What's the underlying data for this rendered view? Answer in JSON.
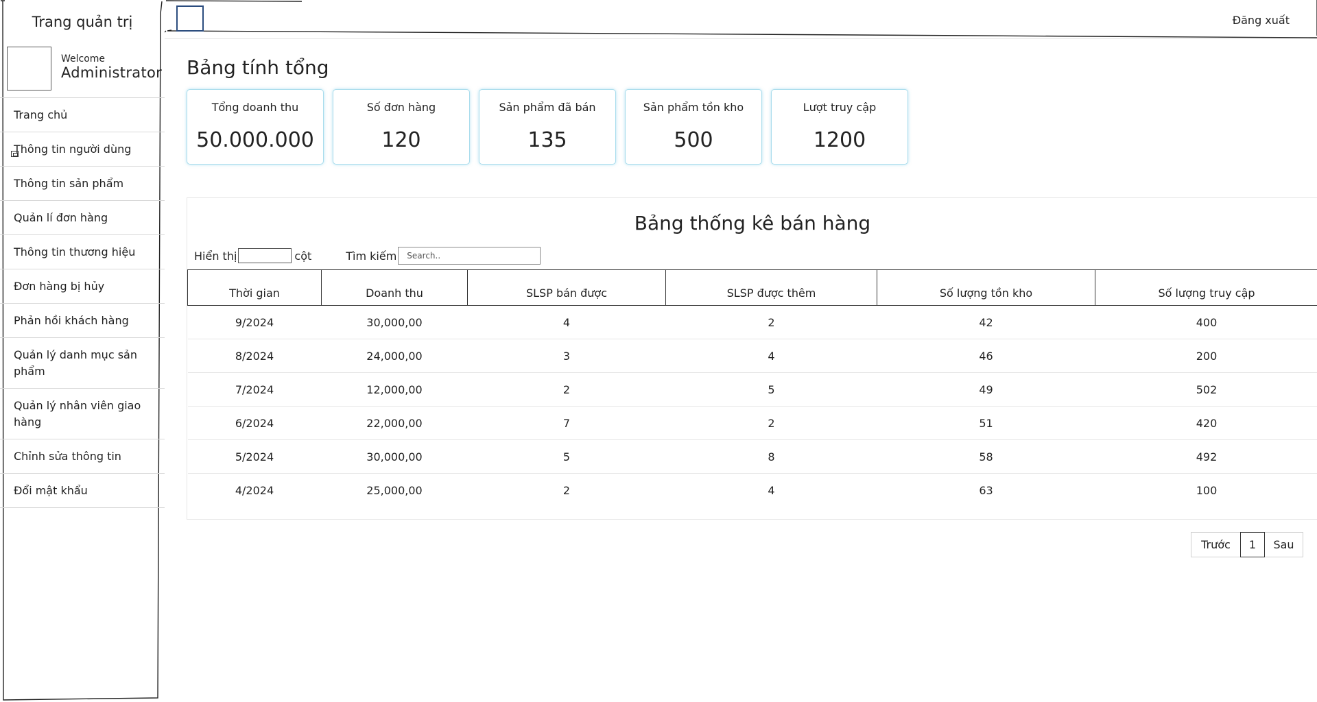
{
  "sidebar": {
    "brand": "Trang quản trị",
    "welcome": "Welcome",
    "username": "Administrator",
    "items": [
      {
        "label": "Trang chủ"
      },
      {
        "label": "Thông tin người dùng"
      },
      {
        "label": "Thông tin sản phẩm"
      },
      {
        "label": "Quản lí đơn hàng"
      },
      {
        "label": "Thông tin thương hiệu"
      },
      {
        "label": "Đơn hàng bị hủy"
      },
      {
        "label": "Phản hồi khách hàng"
      },
      {
        "label": "Quản lý danh mục sản phẩm"
      },
      {
        "label": "Quản lý nhân viên giao hàng"
      },
      {
        "label": "Chỉnh sửa thông tin"
      },
      {
        "label": "Đổi mật khẩu"
      }
    ]
  },
  "header": {
    "logout": "Đăng xuất"
  },
  "main": {
    "summary_title": "Bảng tính tổng",
    "cards": [
      {
        "label": "Tổng doanh thu",
        "value": "50.000.000"
      },
      {
        "label": "Số đơn hàng",
        "value": "120"
      },
      {
        "label": "Sản phẩm đã bán",
        "value": "135"
      },
      {
        "label": "Sản phẩm tồn kho",
        "value": "500"
      },
      {
        "label": "Lượt truy cập",
        "value": "1200"
      }
    ],
    "table_title": "Bảng thống kê bán hàng",
    "controls": {
      "show_label": "Hiển thị",
      "show_input_value": "",
      "columns_label": "cột",
      "search_label": "Tìm kiếm",
      "search_placeholder": "Search.."
    },
    "table": {
      "columns": [
        "Thời gian",
        "Doanh thu",
        "SLSP bán được",
        "SLSP được thêm",
        "Số lượng tồn kho",
        "Số lượng truy cập"
      ],
      "rows": [
        [
          "9/2024",
          "30,000,00",
          "4",
          "2",
          "42",
          "400"
        ],
        [
          "8/2024",
          "24,000,00",
          "3",
          "4",
          "46",
          "200"
        ],
        [
          "7/2024",
          "12,000,00",
          "2",
          "5",
          "49",
          "502"
        ],
        [
          "6/2024",
          "22,000,00",
          "7",
          "2",
          "51",
          "420"
        ],
        [
          "5/2024",
          "30,000,00",
          "5",
          "8",
          "58",
          "492"
        ],
        [
          "4/2024",
          "25,000,00",
          "2",
          "4",
          "63",
          "100"
        ]
      ]
    },
    "pagination": {
      "prev": "Trước",
      "current": "1",
      "next": "Sau"
    }
  }
}
